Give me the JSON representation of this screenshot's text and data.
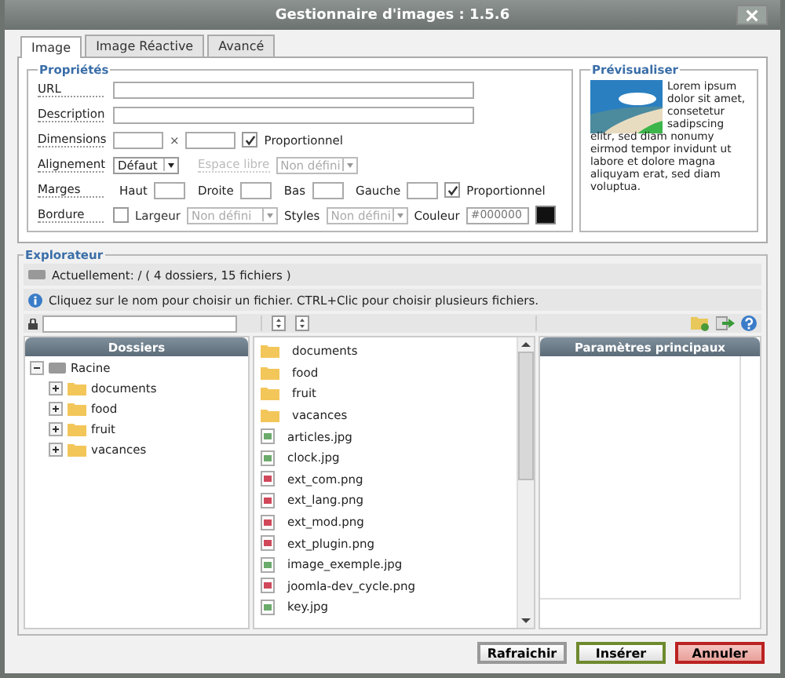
{
  "window": {
    "title": "Gestionnaire d'images : 1.5.6"
  },
  "tabs": [
    {
      "label": "Image",
      "selected": true
    },
    {
      "label": "Image Réactive",
      "selected": false
    },
    {
      "label": "Avancé",
      "selected": false
    }
  ],
  "properties": {
    "legend": "Propriétés",
    "url": {
      "label": "URL"
    },
    "description": {
      "label": "Description"
    },
    "dimensions": {
      "label": "Dimensions",
      "separator": "×",
      "proportional": {
        "label": "Proportionnel",
        "checked": true
      }
    },
    "alignment": {
      "label": "Alignement",
      "value": "Défaut",
      "space_label": "Espace libre",
      "space_disabled": true,
      "space_value": "Non défini"
    },
    "margins": {
      "label": "Marges",
      "sides": [
        "Haut",
        "Droite",
        "Bas",
        "Gauche"
      ],
      "proportional": {
        "label": "Proportionnel",
        "checked": true
      }
    },
    "border": {
      "label": "Bordure",
      "enabled": {
        "label": "Largeur",
        "checked": false
      },
      "width_value": "Non défini",
      "styles_label": "Styles",
      "styles_value": "Non défini",
      "color_label": "Couleur",
      "color_placeholder": "#000000"
    }
  },
  "preview": {
    "legend": "Prévisualiser",
    "text": "Lorem ipsum dolor sit amet, consetetur sadipscing elitr, sed diam nonumy eirmod tempor invidunt ut labore et dolore magna aliquyam erat, sed diam voluptua."
  },
  "explorer": {
    "legend": "Explorateur",
    "current": "Actuellement: / ( 4 dossiers, 15 fichiers )",
    "info": "Cliquez sur le nom pour choisir un fichier. CTRL+Clic pour choisir plusieurs fichiers.",
    "folders_header": "Dossiers",
    "tree": {
      "label": "Racine",
      "expanded": true,
      "children": [
        {
          "label": "documents",
          "expanded": false
        },
        {
          "label": "food",
          "expanded": false
        },
        {
          "label": "fruit",
          "expanded": false
        },
        {
          "label": "vacances",
          "expanded": false
        }
      ]
    },
    "files": [
      {
        "name": "documents",
        "kind": "folder"
      },
      {
        "name": "food",
        "kind": "folder"
      },
      {
        "name": "fruit",
        "kind": "folder"
      },
      {
        "name": "vacances",
        "kind": "folder"
      },
      {
        "name": "articles.jpg",
        "kind": "jpg"
      },
      {
        "name": "clock.jpg",
        "kind": "jpg"
      },
      {
        "name": "ext_com.png",
        "kind": "png"
      },
      {
        "name": "ext_lang.png",
        "kind": "png"
      },
      {
        "name": "ext_mod.png",
        "kind": "png"
      },
      {
        "name": "ext_plugin.png",
        "kind": "png"
      },
      {
        "name": "image_exemple.jpg",
        "kind": "jpg"
      },
      {
        "name": "joomla-dev_cycle.png",
        "kind": "png"
      },
      {
        "name": "key.jpg",
        "kind": "jpg"
      }
    ],
    "params_header": "Paramètres principaux"
  },
  "buttons": [
    {
      "label": "Rafraichir",
      "kind": "refresh"
    },
    {
      "label": "Insérer",
      "kind": "insert"
    },
    {
      "label": "Annuler",
      "kind": "cancel"
    }
  ]
}
